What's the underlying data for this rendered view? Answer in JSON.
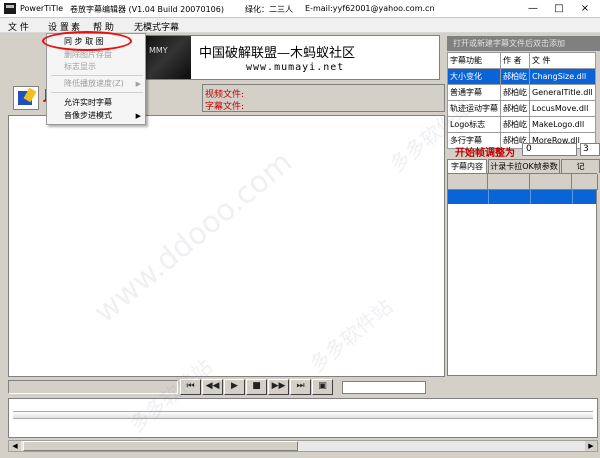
{
  "window": {
    "title": "PowerTiTle",
    "subtitle": "卷放字幕编辑器 (V1.04 Build 20070106)",
    "author": "绿化：二三人",
    "email": "E-mail:yyf62001@yahoo.com.cn",
    "minimize": "—",
    "maximize": "□",
    "close": "×"
  },
  "menu": {
    "file": "文  件",
    "settings": "设  置",
    "help": "帮  助",
    "modeless": "无模式字幕",
    "hidden_item": "素"
  },
  "dropdown": {
    "items": [
      {
        "label": "同 步 取 图",
        "enabled": true
      },
      {
        "label": "删除图片存盘",
        "enabled": false
      },
      {
        "label": "标志显示",
        "enabled": false
      },
      {
        "label": "降低播放速度(Z)",
        "enabled": false,
        "submenu": true
      },
      {
        "label": "允许实时字幕",
        "enabled": true
      },
      {
        "label": "音像步进模式",
        "enabled": true,
        "submenu": true
      }
    ]
  },
  "banner": {
    "logo_text": "MMY",
    "title": "中国破解联盟—木蚂蚁社区",
    "url": "www.mumayi.net"
  },
  "fileinfo": {
    "video_label": "视频文件:",
    "subtitle_label": "字幕文件:"
  },
  "plugin_panel": {
    "header": "打开或新建字幕文件后双击添加",
    "columns": [
      "字幕功能",
      "作  者",
      "文  件"
    ],
    "rows": [
      [
        "大小变化",
        "郝柏屹",
        "ChangSize.dll"
      ],
      [
        "普通字幕",
        "郝柏屹",
        "GeneralTitle.dll"
      ],
      [
        "轨迹运动字幕",
        "郝柏屹",
        "LocusMove.dll"
      ],
      [
        "Logo标志",
        "郝柏屹",
        "MakeLogo.dll"
      ],
      [
        "多行字幕",
        "郝柏屹",
        "MoreRow.dll"
      ]
    ]
  },
  "adjust": {
    "label": "开始帧调整为",
    "value": "0",
    "value2": "3"
  },
  "tabs": [
    "字幕内容",
    "计录卡拉OK帧参数",
    "记"
  ],
  "transport": {
    "first": "⏮",
    "prev": "◀◀",
    "play": "▶",
    "stop": "■",
    "next": "▶▶",
    "last": "⏭",
    "capture": "▣"
  },
  "scroll": {
    "left": "◀",
    "right": "▶"
  }
}
